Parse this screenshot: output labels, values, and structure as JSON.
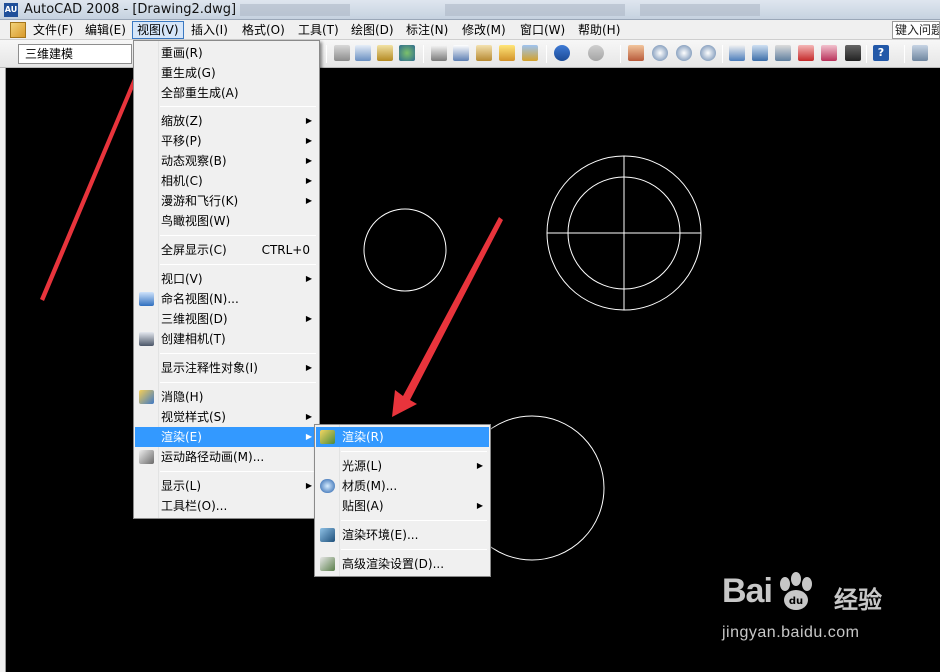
{
  "window": {
    "title": "AutoCAD 2008 - [Drawing2.dwg]",
    "app_icon_text": "AU"
  },
  "menubar": {
    "items": [
      "文件(F)",
      "编辑(E)",
      "视图(V)",
      "插入(I)",
      "格式(O)",
      "工具(T)",
      "绘图(D)",
      "标注(N)",
      "修改(M)",
      "窗口(W)",
      "帮助(H)"
    ],
    "search_text": "键入问题"
  },
  "toolbar": {
    "workspace": "三维建模"
  },
  "view_menu": {
    "items": [
      {
        "label": "重画(R)",
        "icon": null
      },
      {
        "label": "重生成(G)",
        "icon": null
      },
      {
        "label": "全部重生成(A)",
        "icon": null
      },
      {
        "label": "缩放(Z)",
        "icon": null,
        "submenu": true
      },
      {
        "label": "平移(P)",
        "icon": null,
        "submenu": true
      },
      {
        "label": "动态观察(B)",
        "icon": null,
        "submenu": true
      },
      {
        "label": "相机(C)",
        "icon": null,
        "submenu": true
      },
      {
        "label": "漫游和飞行(K)",
        "icon": null,
        "submenu": true
      },
      {
        "label": "鸟瞰视图(W)",
        "icon": null
      },
      {
        "label": "全屏显示(C)",
        "shortcut": "CTRL+0",
        "icon": null
      },
      {
        "label": "视口(V)",
        "icon": null,
        "submenu": true
      },
      {
        "label": "命名视图(N)...",
        "icon": "named-view-icon"
      },
      {
        "label": "三维视图(D)",
        "icon": null,
        "submenu": true
      },
      {
        "label": "创建相机(T)",
        "icon": "camera-icon"
      },
      {
        "label": "显示注释性对象(I)",
        "icon": null,
        "submenu": true
      },
      {
        "label": "消隐(H)",
        "icon": "hide-icon"
      },
      {
        "label": "视觉样式(S)",
        "icon": null,
        "submenu": true
      },
      {
        "label": "渲染(E)",
        "icon": null,
        "submenu": true,
        "highlighted": true
      },
      {
        "label": "运动路径动画(M)...",
        "icon": "motion-path-icon"
      },
      {
        "label": "显示(L)",
        "icon": null,
        "submenu": true
      },
      {
        "label": "工具栏(O)...",
        "icon": null
      }
    ]
  },
  "render_submenu": {
    "items": [
      {
        "label": "渲染(R)",
        "icon": "render-icon",
        "highlighted": true
      },
      {
        "label": "光源(L)",
        "icon": null,
        "submenu": true
      },
      {
        "label": "材质(M)...",
        "icon": "materials-icon"
      },
      {
        "label": "贴图(A)",
        "icon": null,
        "submenu": true
      },
      {
        "label": "渲染环境(E)...",
        "icon": "render-environment-icon"
      },
      {
        "label": "高级渲染设置(D)...",
        "icon": "advanced-render-settings-icon"
      }
    ]
  },
  "watermark": {
    "logo_text": "Bai",
    "logo_text_2": "du",
    "brand": "经验",
    "url": "jingyan.baidu.com"
  },
  "colors": {
    "canvas_bg": "#000000",
    "drawing_line": "#ffffff",
    "annotation_arrow": "#e8343c",
    "menu_highlight": "#3399ff"
  }
}
